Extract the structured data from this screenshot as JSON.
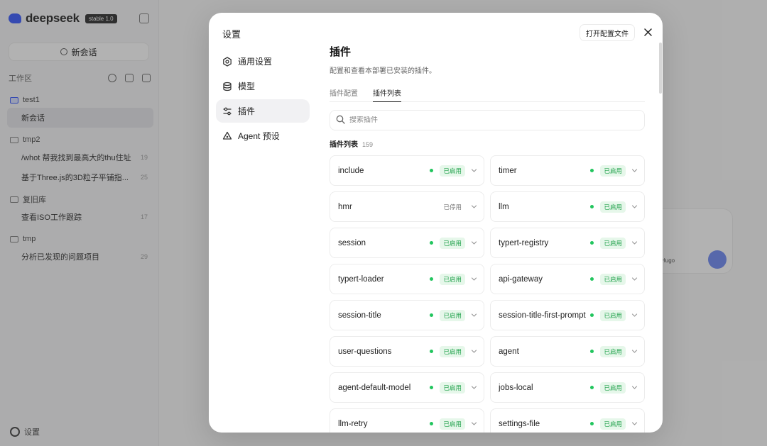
{
  "app": {
    "logo_text": "deepseek",
    "logo_badge": "stable 1.0",
    "new_chat_label": "新会话",
    "workspace_label": "工作区",
    "settings_label": "设置",
    "groups": [
      {
        "name": "test1",
        "items": [
          {
            "title": "新会话",
            "count": ""
          }
        ]
      },
      {
        "name": "tmp2",
        "items": [
          {
            "title": "/whot 帮我找到最高大的thu住址",
            "count": "19"
          },
          {
            "title": "基于Three.js的3D粒子平铺指...",
            "count": "25"
          }
        ]
      },
      {
        "name": "复旧库",
        "items": [
          {
            "title": "查看ISO工作跟踪",
            "count": "17"
          }
        ]
      },
      {
        "name": "tmp",
        "items": [
          {
            "title": "分析已发现的问题项目",
            "count": "29"
          }
        ]
      }
    ],
    "bg_card_label": "Hugo"
  },
  "modal": {
    "title": "设置",
    "nav": [
      {
        "label": "通用设置",
        "icon": "gear-icon",
        "active": false
      },
      {
        "label": "模型",
        "icon": "database-icon",
        "active": false
      },
      {
        "label": "插件",
        "icon": "sliders-icon",
        "active": true
      },
      {
        "label": "Agent 预设",
        "icon": "recycle-icon",
        "active": false
      }
    ],
    "open_config_label": "打开配置文件",
    "section_title": "插件",
    "section_desc": "配置和查看本部署已安装的插件。",
    "tabs": [
      {
        "label": "插件配置",
        "active": false
      },
      {
        "label": "插件列表",
        "active": true
      }
    ],
    "search_placeholder": "搜索插件",
    "list_title": "插件列表",
    "list_count": "159",
    "plugins": [
      {
        "name": "include",
        "status": "已启用",
        "enabled": true
      },
      {
        "name": "timer",
        "status": "已启用",
        "enabled": true
      },
      {
        "name": "hmr",
        "status": "已停用",
        "enabled": false
      },
      {
        "name": "llm",
        "status": "已启用",
        "enabled": true
      },
      {
        "name": "session",
        "status": "已启用",
        "enabled": true
      },
      {
        "name": "typert-registry",
        "status": "已启用",
        "enabled": true
      },
      {
        "name": "typert-loader",
        "status": "已启用",
        "enabled": true
      },
      {
        "name": "api-gateway",
        "status": "已启用",
        "enabled": true
      },
      {
        "name": "session-title",
        "status": "已启用",
        "enabled": true
      },
      {
        "name": "session-title-first-prompt",
        "status": "已启用",
        "enabled": true
      },
      {
        "name": "user-questions",
        "status": "已启用",
        "enabled": true
      },
      {
        "name": "agent",
        "status": "已启用",
        "enabled": true
      },
      {
        "name": "agent-default-model",
        "status": "已启用",
        "enabled": true
      },
      {
        "name": "jobs-local",
        "status": "已启用",
        "enabled": true
      },
      {
        "name": "llm-retry",
        "status": "已启用",
        "enabled": true
      },
      {
        "name": "settings-file",
        "status": "已启用",
        "enabled": true
      }
    ],
    "colors": {
      "enabled_green": "#22c55e",
      "badge_green_bg": "#e6f7ea",
      "accent": "#4d6bfe"
    }
  }
}
